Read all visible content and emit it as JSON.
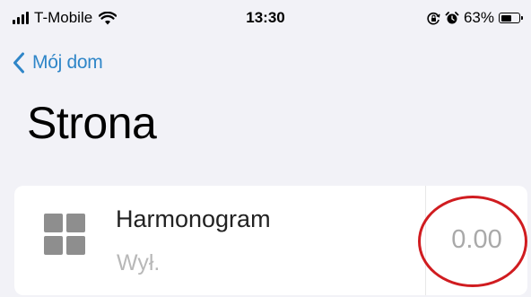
{
  "status_bar": {
    "carrier": "T-Mobile",
    "time": "13:30",
    "battery_percent": "63%",
    "battery_level": 0.63,
    "icons": [
      "cellular-signal-icon",
      "wifi-icon",
      "orientation-lock-icon",
      "alarm-icon",
      "battery-icon"
    ]
  },
  "nav": {
    "back_label": "Mój dom"
  },
  "page": {
    "title": "Strona"
  },
  "device_card": {
    "name": "Harmonogram",
    "status": "Wył.",
    "value": "0.00",
    "icon": "grid-icon"
  },
  "annotation": {
    "highlight_color": "#d01c20"
  },
  "colors": {
    "accent": "#2f86c8",
    "background": "#f2f2f7"
  }
}
